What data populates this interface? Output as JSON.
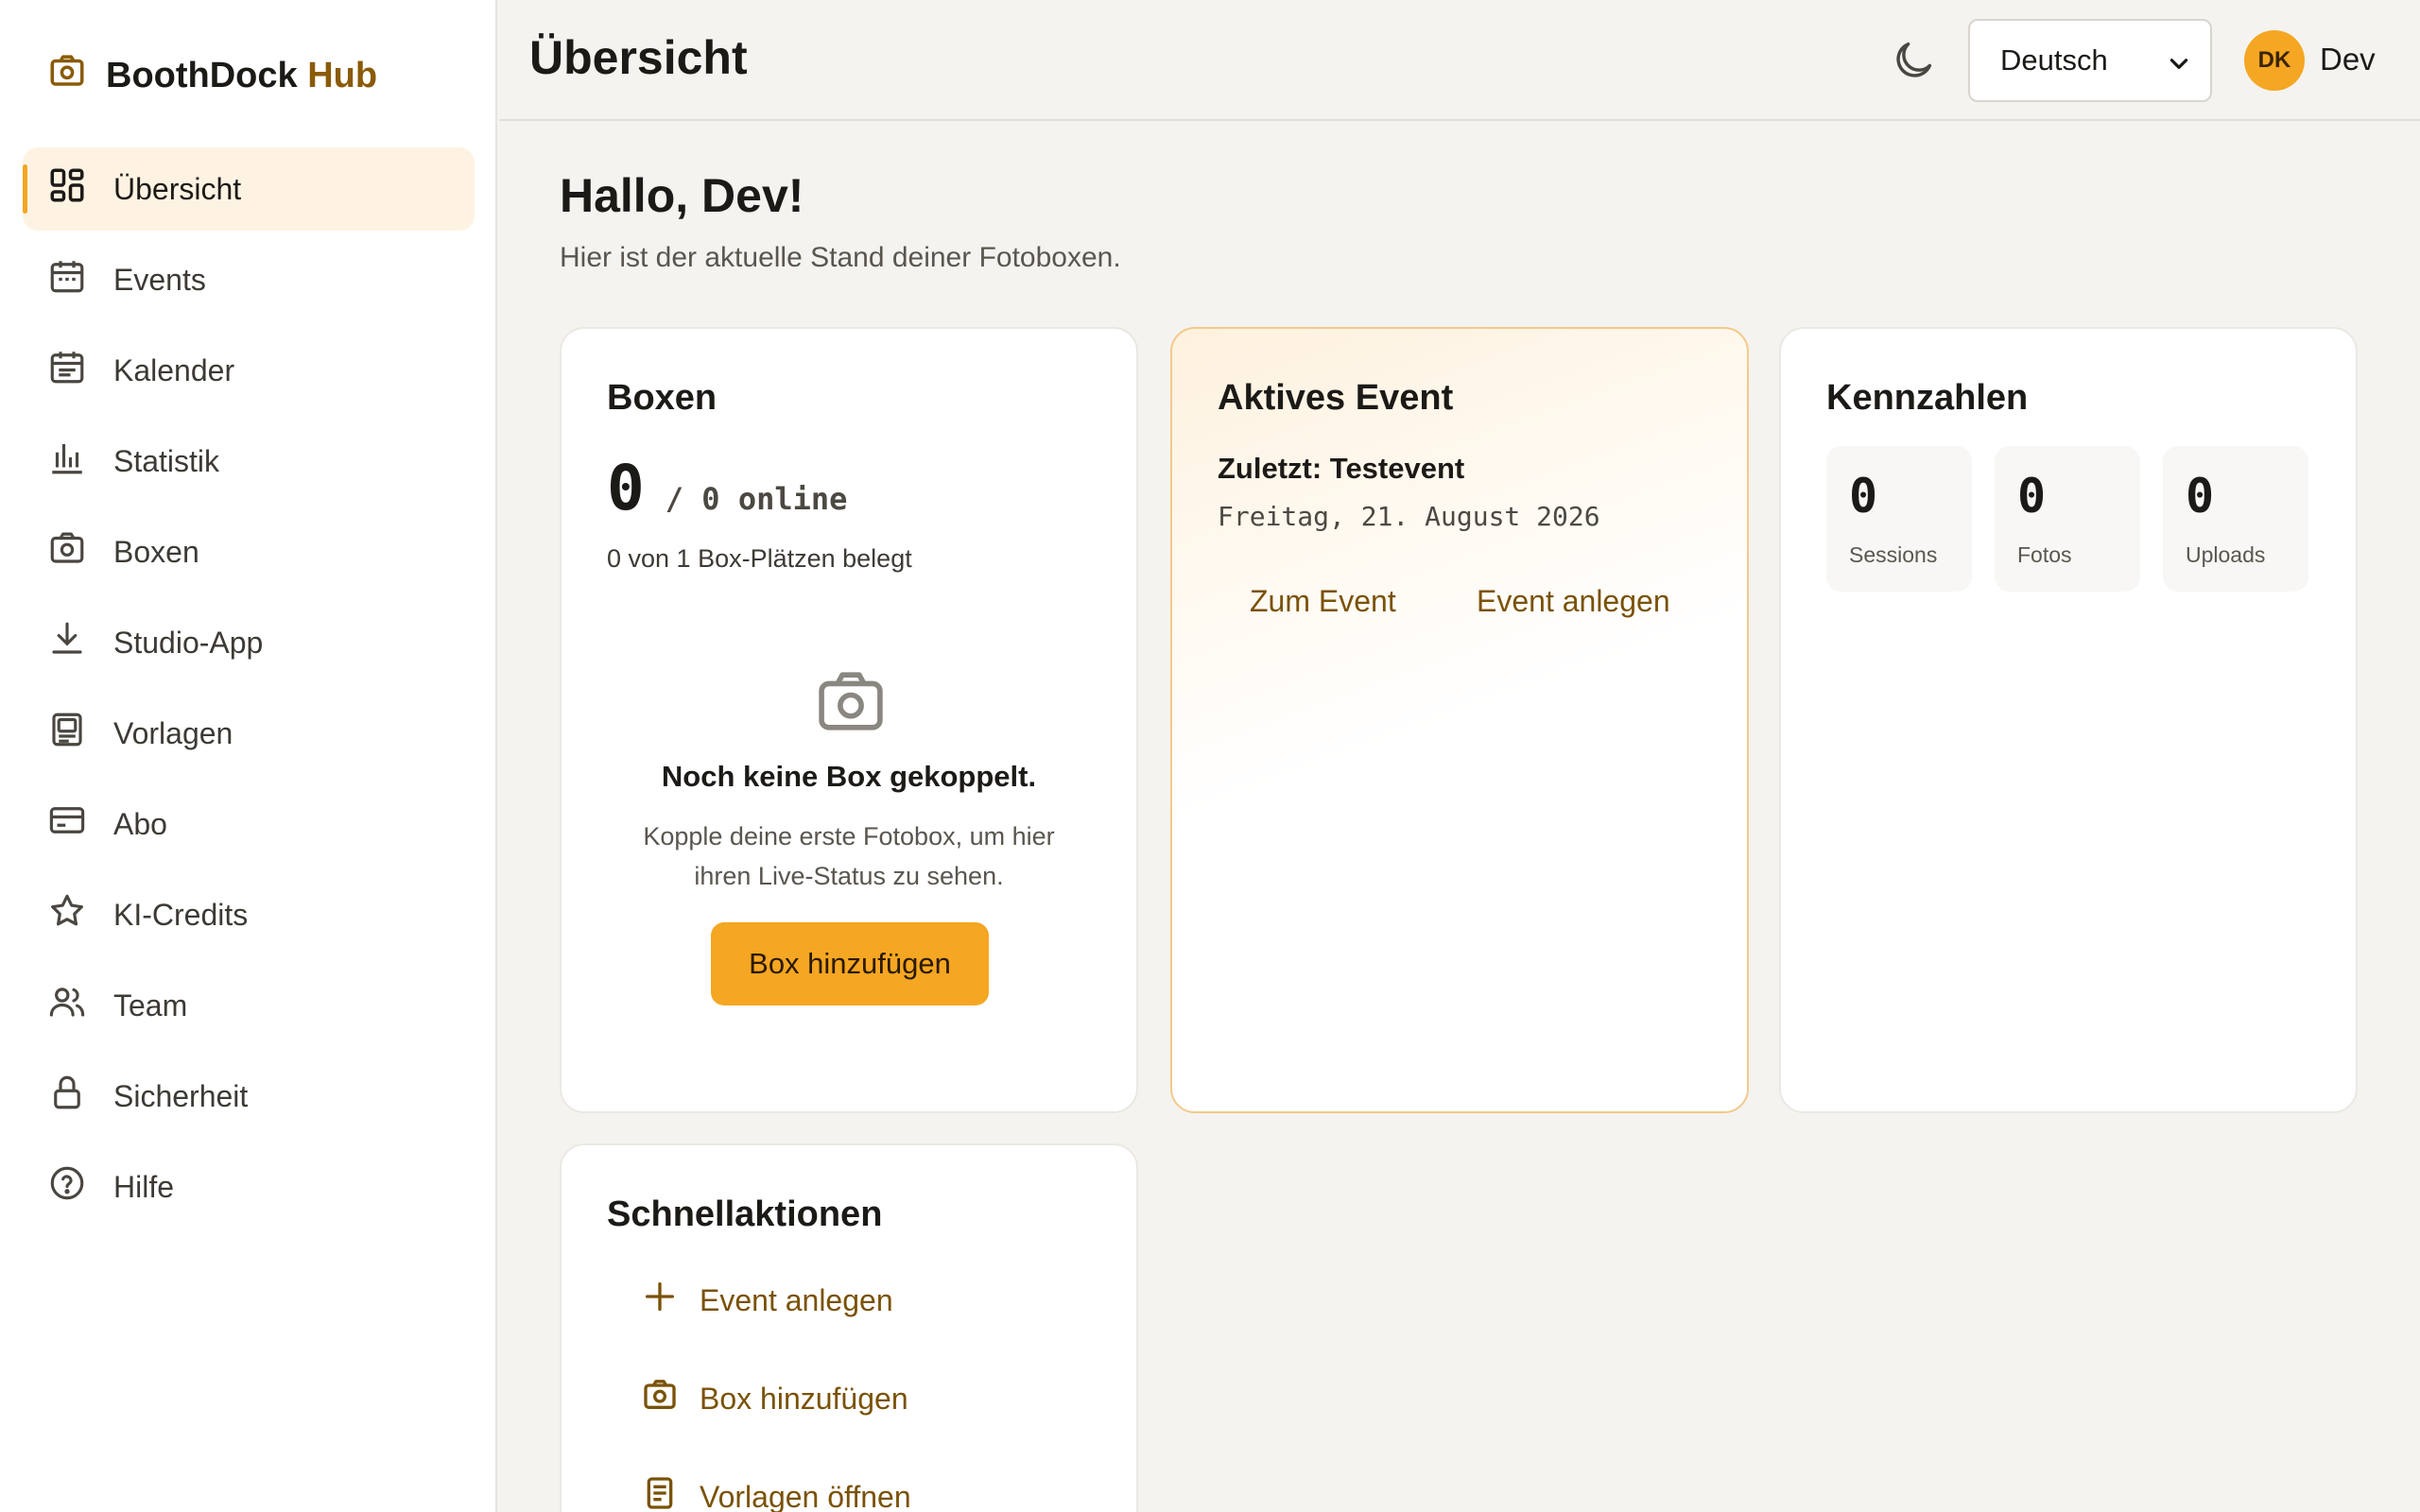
{
  "brand": {
    "name": "BoothDock",
    "accent": "Hub",
    "icon": "camera-icon"
  },
  "sidebar": {
    "items": [
      {
        "label": "Übersicht",
        "icon": "dashboard-icon",
        "active": true
      },
      {
        "label": "Events",
        "icon": "calendar-icon"
      },
      {
        "label": "Kalender",
        "icon": "calendar-lines-icon"
      },
      {
        "label": "Statistik",
        "icon": "bar-chart-icon"
      },
      {
        "label": "Boxen",
        "icon": "camera-icon"
      },
      {
        "label": "Studio-App",
        "icon": "download-icon"
      },
      {
        "label": "Vorlagen",
        "icon": "template-icon"
      },
      {
        "label": "Abo",
        "icon": "credit-card-icon"
      },
      {
        "label": "KI-Credits",
        "icon": "star-icon"
      },
      {
        "label": "Team",
        "icon": "users-icon"
      },
      {
        "label": "Sicherheit",
        "icon": "lock-icon"
      },
      {
        "label": "Hilfe",
        "icon": "help-icon"
      }
    ]
  },
  "header": {
    "title": "Übersicht",
    "theme_icon": "moon-icon",
    "language": "Deutsch",
    "avatar_initials": "DK",
    "user_name": "Dev"
  },
  "main": {
    "greeting": "Hallo, Dev!",
    "subtitle": "Hier ist der aktuelle Stand deiner Fotoboxen."
  },
  "boxes_card": {
    "title": "Boxen",
    "online_count": "0",
    "online_suffix": "/ 0 online",
    "slots_text": "0 von 1 Box-Plätzen belegt",
    "empty_title": "Noch keine Box gekoppelt.",
    "empty_text": "Kopple deine erste Fotobox, um hier ihren Live-Status zu sehen.",
    "add_button": "Box hinzufügen"
  },
  "event_card": {
    "title": "Aktives Event",
    "last_event": "Zuletzt: Testevent",
    "date": "Freitag, 21. August 2026",
    "goto_label": "Zum Event",
    "create_label": "Event anlegen"
  },
  "stats_card": {
    "title": "Kennzahlen",
    "stats": [
      {
        "value": "0",
        "label": "Sessions"
      },
      {
        "value": "0",
        "label": "Fotos"
      },
      {
        "value": "0",
        "label": "Uploads"
      }
    ]
  },
  "quick_card": {
    "title": "Schnellaktionen",
    "actions": [
      {
        "label": "Event anlegen",
        "icon": "plus-icon"
      },
      {
        "label": "Box hinzufügen",
        "icon": "camera-icon"
      },
      {
        "label": "Vorlagen öffnen",
        "icon": "document-icon"
      }
    ]
  },
  "colors": {
    "accent": "#f5a623",
    "link": "#7a5206",
    "brand_accent": "#8a5a06"
  }
}
